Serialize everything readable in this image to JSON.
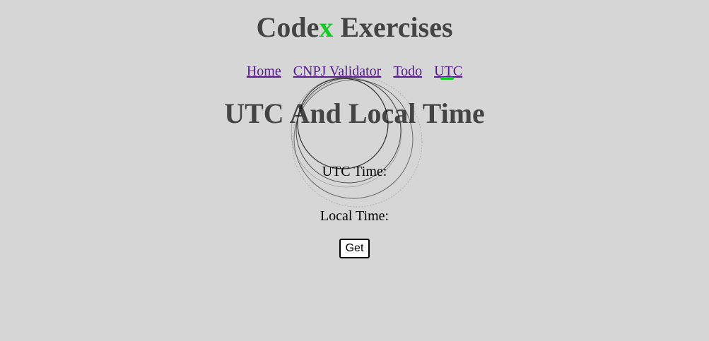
{
  "header": {
    "title_prefix": "Code",
    "title_accent": "x",
    "title_suffix": " Exercises",
    "accent_color": "#11cc22"
  },
  "nav": {
    "items": [
      {
        "label": "Home"
      },
      {
        "label": "CNPJ Validator"
      },
      {
        "label": "Todo"
      },
      {
        "label": "UTC",
        "active": true
      }
    ]
  },
  "main": {
    "heading": "UTC And Local Time",
    "utc_label": "UTC Time:",
    "local_label": "Local Time:",
    "get_button_label": "Get"
  }
}
